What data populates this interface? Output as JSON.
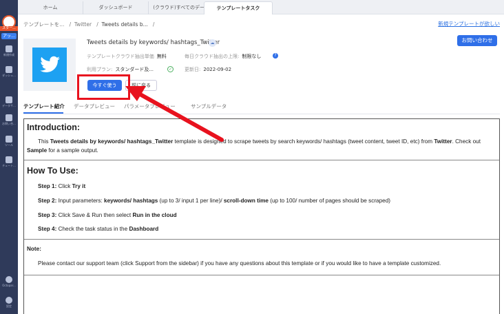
{
  "tabs": [
    "ホーム",
    "ダッシュボード",
    "(クラウド)すべてのデー...",
    "テンプレートタスク"
  ],
  "sidebar": {
    "badge_top": "スター...",
    "badge_upgrade": "アッ...",
    "items": [
      "新規作成",
      "ダッシュ...",
      "データサ...",
      "お問い合...",
      "ツール",
      "チュート..."
    ],
    "bottom_items": [
      "Octopar...",
      "設定"
    ]
  },
  "breadcrumb": {
    "level1": "テンプレートを...",
    "level2": "Twitter",
    "level3": "Tweets details b..."
  },
  "new_template_link": "新規テンプレートが欲しい",
  "contact_button": "お問い合わせ",
  "template": {
    "title": "Tweets details by keywords/ hashtags_Twitter",
    "cloud_price_label": "テンプレートクラウド抽出単価",
    "cloud_price_value": "無料",
    "daily_limit_label": "毎日クラウド抽出の上限:",
    "daily_limit_value": "制限なし",
    "plan_label": "利用プラン:",
    "plan_value": "スタンダード及...",
    "updated_label": "更新日:",
    "updated_value": "2022-09-02",
    "use_button": "今すぐ使う",
    "back_button": "前に戻る"
  },
  "content_tabs": [
    "テンプレート紹介",
    "データプレビュー",
    "パラメータプレビュー",
    "サンプルデータ"
  ],
  "content": {
    "intro_heading": "Introduction:",
    "intro_p1": "This ",
    "intro_b1": "Tweets details by keywords/ hashtags_Twitter",
    "intro_p2": " template is designed to scrape tweets by search keywords/ hashtags (tweet content, tweet ID, etc) from ",
    "intro_b2": "Twitter",
    "intro_p3": ". Check out ",
    "intro_b3": "Sample",
    "intro_p4": " for a sample output.",
    "howto_heading": "How To Use:",
    "step1_label": "Step 1:",
    "step1_text": " Click ",
    "step1_bold": "Try it",
    "step2_label": "Step 2:",
    "step2_text": " Input parameters: ",
    "step2_bold1": "keywords/ hashtags",
    "step2_text2": " (up to 3/ input 1 per line)/ ",
    "step2_bold2": "scroll-down time",
    "step2_text3": " (up to 100/ number of pages should be scraped)",
    "step3_label": "Step 3:",
    "step3_text": " Click Save & Run then select ",
    "step3_bold": "Run in the cloud",
    "step4_label": "Step 4:",
    "step4_text": " Check the task status in the ",
    "step4_bold": "Dashboard",
    "note_heading": "Note:",
    "note_text": "Please contact our support team (click Support from the sidebar) if you have any questions about this template or if you would like to have a template customized."
  },
  "colors": {
    "primary": "#2f6fe8",
    "highlight": "#e8121e",
    "sidebar": "#2f3a5a",
    "twitter": "#1da1f2"
  }
}
